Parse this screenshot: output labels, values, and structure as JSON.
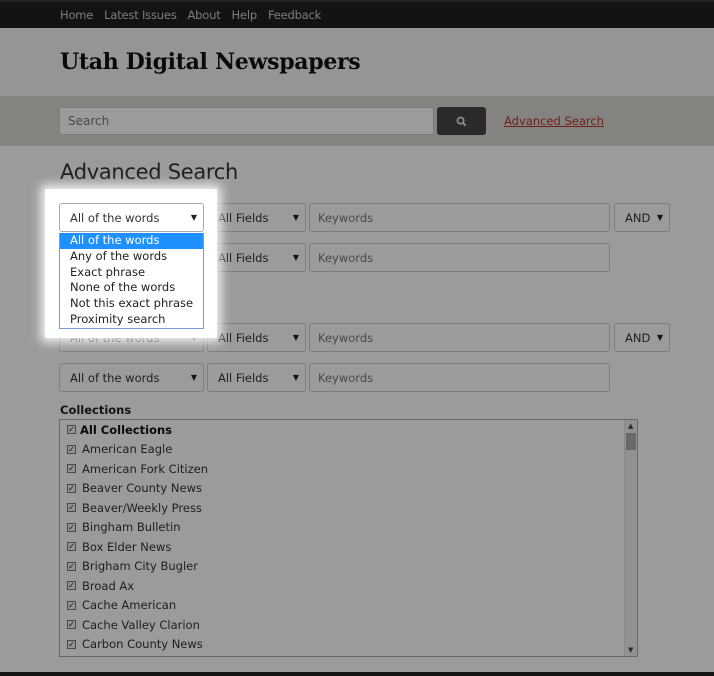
{
  "nav": {
    "items": [
      "Home",
      "Latest Issues",
      "About",
      "Help",
      "Feedback"
    ]
  },
  "header": {
    "title": "Utah Digital Newspapers"
  },
  "search": {
    "placeholder": "Search",
    "button_icon": "search-icon",
    "advanced_link": "Advanced Search"
  },
  "main": {
    "heading": "Advanced Search",
    "rows": [
      {
        "mode": "All of the words",
        "field": "All Fields",
        "keywords_placeholder": "Keywords",
        "operator": "AND"
      },
      {
        "mode": "All of the words",
        "field": "All Fields",
        "keywords_placeholder": "Keywords"
      },
      {
        "mode": "All of the words",
        "field": "All Fields",
        "keywords_placeholder": "Keywords",
        "operator": "AND"
      },
      {
        "mode": "All of the words",
        "field": "All Fields",
        "keywords_placeholder": "Keywords"
      }
    ],
    "mode_dropdown": {
      "selected": "All of the words",
      "options": [
        "All of the words",
        "Any of the words",
        "Exact phrase",
        "None of the words",
        "Not this exact phrase",
        "Proximity search"
      ],
      "highlighted_index": 0
    },
    "collections": {
      "label": "Collections",
      "items": [
        {
          "label": "All Collections",
          "checked": true
        },
        {
          "label": "American Eagle",
          "checked": true
        },
        {
          "label": "American Fork Citizen",
          "checked": true
        },
        {
          "label": "Beaver County News",
          "checked": true
        },
        {
          "label": "Beaver/Weekly Press",
          "checked": true
        },
        {
          "label": "Bingham Bulletin",
          "checked": true
        },
        {
          "label": "Box Elder News",
          "checked": true
        },
        {
          "label": "Brigham City Bugler",
          "checked": true
        },
        {
          "label": "Broad Ax",
          "checked": true
        },
        {
          "label": "Cache American",
          "checked": true
        },
        {
          "label": "Cache Valley Clarion",
          "checked": true
        },
        {
          "label": "Carbon County News",
          "checked": true
        }
      ]
    }
  },
  "colors": {
    "link": "#b3352a",
    "highlight": "#1e90ff",
    "nav_bg": "#1f1f1f"
  }
}
